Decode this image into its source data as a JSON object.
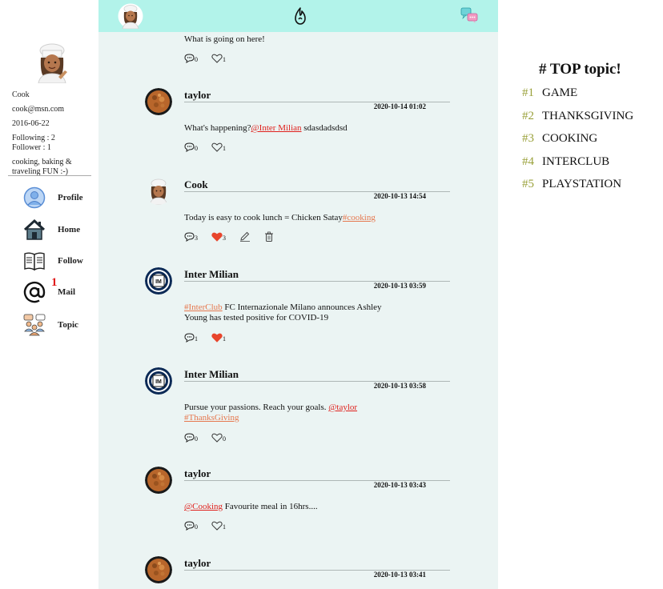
{
  "profile": {
    "name": "Cook",
    "email": "cook@msn.com",
    "joined": "2016-06-22",
    "following": "Following : 2",
    "follower": "Follower : 1",
    "bio": "cooking, baking & traveling FUN :-)"
  },
  "nav": {
    "profile": "Profile",
    "home": "Home",
    "follow": "Follow",
    "mail": "Mail",
    "mail_count": "1",
    "topic": "Topic"
  },
  "posts": [
    {
      "author": "",
      "time": "",
      "body": "What is going on here!",
      "comments": "0",
      "likes": "1",
      "liked": false
    },
    {
      "author": "taylor",
      "time": "2020-10-14 01:02",
      "body_pre": "What's happening?",
      "mention": "@Inter Milian",
      "body_post": " sdasdadsdsd",
      "comments": "0",
      "likes": "1",
      "liked": false
    },
    {
      "author": "Cook",
      "time": "2020-10-13 14:54",
      "body_pre": " Today is easy to cook lunch = Chicken Satay",
      "tag": "#cooking",
      "comments": "3",
      "likes": "3",
      "liked": true
    },
    {
      "author": "Inter Milian",
      "time": "2020-10-13 03:59",
      "tag": "#InterClub",
      "body_post": "  FC Internazionale Milano announces Ashley Young has tested positive for COVID-19",
      "comments": "1",
      "likes": "1",
      "liked": true
    },
    {
      "author": "Inter Milian",
      "time": "2020-10-13 03:58",
      "body_pre": "Pursue your passions. Reach your goals. ",
      "mention": "@taylor",
      "tag": "#ThanksGiving",
      "comments": "0",
      "likes": "0",
      "liked": false
    },
    {
      "author": "taylor",
      "time": "2020-10-13 03:43",
      "mention": "@Cooking",
      "body_post": "  Favourite meal in 16hrs....",
      "comments": "0",
      "likes": "1",
      "liked": false
    },
    {
      "author": "taylor",
      "time": "2020-10-13 03:41"
    }
  ],
  "topics": {
    "title": "# TOP topic!",
    "items": [
      {
        "rank": "#1",
        "name": "GAME"
      },
      {
        "rank": "#2",
        "name": "THANKSGIVING"
      },
      {
        "rank": "#3",
        "name": "COOKING"
      },
      {
        "rank": "#4",
        "name": "INTERCLUB"
      },
      {
        "rank": "#5",
        "name": "PLAYSTATION"
      }
    ]
  },
  "colors": {
    "header_bg": "#b2f3ea",
    "feed_bg": "#ebf4f3",
    "mention": "#e0201c",
    "hashtag": "#e6784f",
    "liked_heart": "#e8452c",
    "rank": "#9aa13b"
  },
  "icons": {
    "header_left": "chef-avatar-icon",
    "header_center": "flame-logo-icon",
    "header_right": "chat-bubbles-icon",
    "comment": "comment-icon",
    "like": "heart-icon",
    "edit": "pencil-icon",
    "delete": "trash-icon"
  }
}
